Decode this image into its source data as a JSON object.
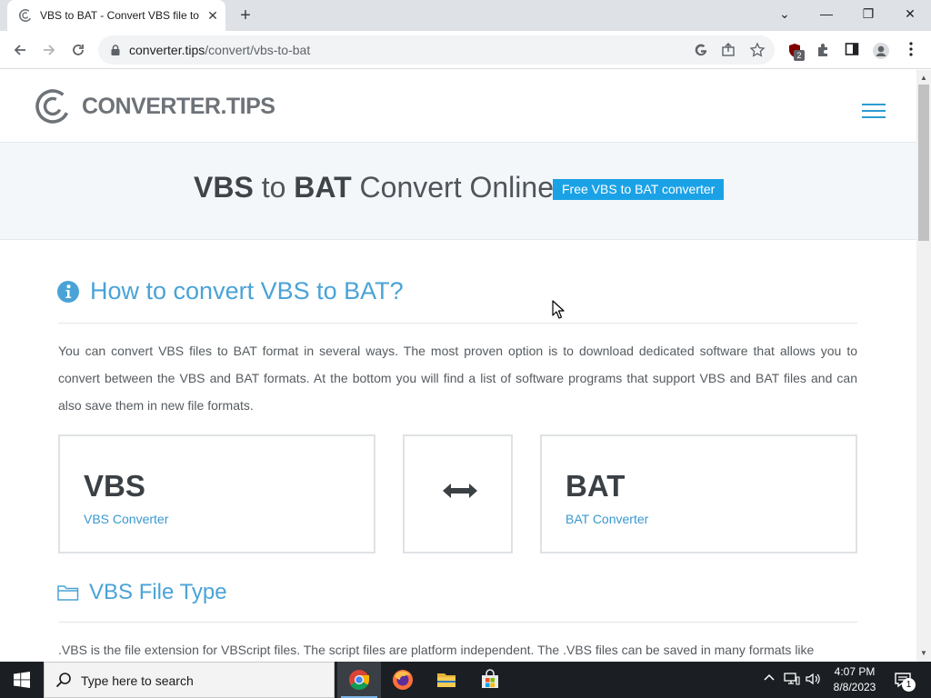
{
  "browser": {
    "tab_title": "VBS to BAT - Convert VBS file to",
    "tab_close": "✕",
    "new_tab": "+",
    "window_controls": {
      "dropdown": "⌄",
      "minimize": "—",
      "restore": "❐",
      "close": "✕"
    },
    "url_host": "converter.tips",
    "url_path": "/convert/vbs-to-bat",
    "extension_badge": "2"
  },
  "site": {
    "logo_text": "CONVERTER.TIPS",
    "hero_title_from": "VBS",
    "hero_title_to_word": "to",
    "hero_title_target": "BAT",
    "hero_title_suffix": "Convert Online",
    "hero_badge": "Free VBS to BAT converter",
    "how_heading": "How to convert VBS to BAT?",
    "intro_text": "You can convert VBS files to BAT format in several ways. The most proven option is to download dedicated software that allows you to convert between the VBS and BAT formats. At the bottom you will find a list of software programs that support VBS and BAT files and can also save them in new file formats.",
    "source": {
      "ext": "VBS",
      "link": "VBS Converter"
    },
    "target": {
      "ext": "BAT",
      "link": "BAT Converter"
    },
    "file_type_heading": "VBS File Type",
    "file_type_text": ".VBS is the file extension for VBScript files. The script files are platform independent. The .VBS files can be saved in many formats like"
  },
  "taskbar": {
    "search_placeholder": "Type here to search",
    "time": "4:07 PM",
    "date": "8/8/2023",
    "notification_count": "1"
  },
  "colors": {
    "accent_blue": "#1ba2e6",
    "heading_blue": "#4aa3d6",
    "link_blue": "#3a98cf"
  }
}
